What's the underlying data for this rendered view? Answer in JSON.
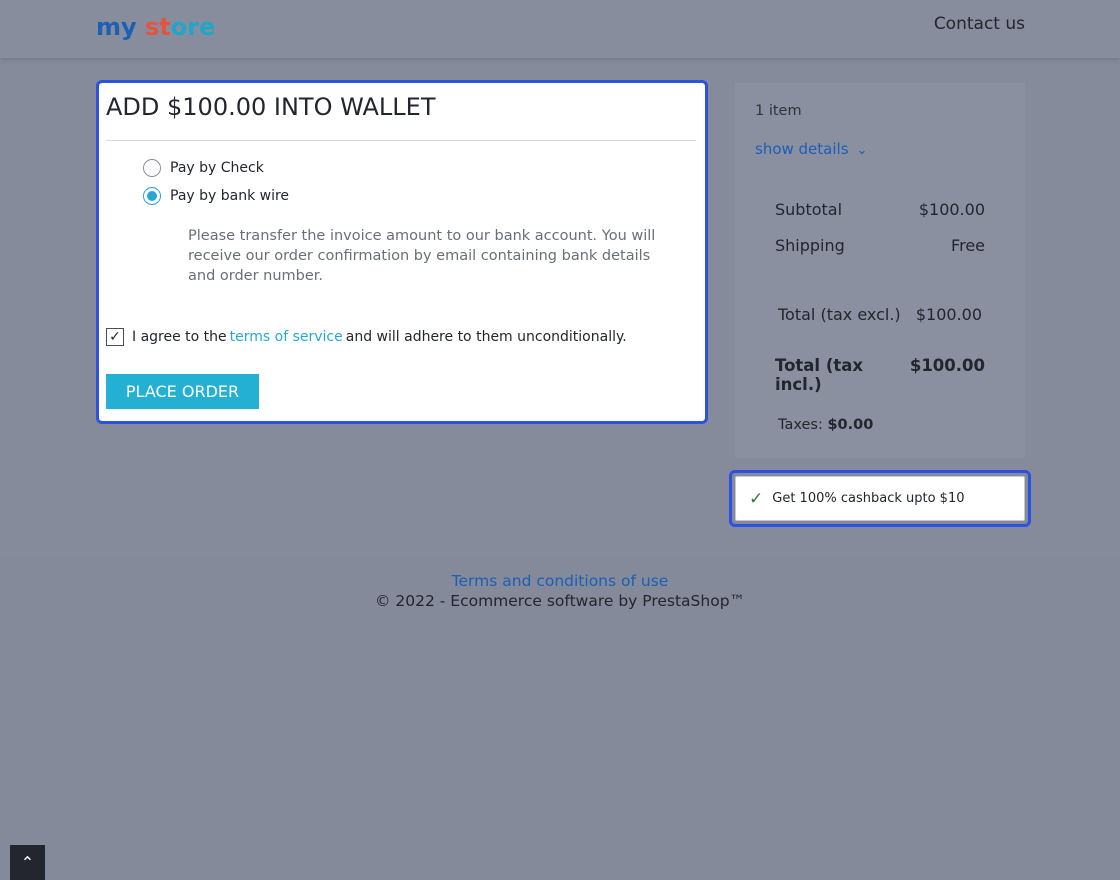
{
  "header": {
    "logo_part1": "my",
    "logo_part2": "st",
    "logo_part3": "ore",
    "contact_label": "Contact us"
  },
  "payment": {
    "title": "ADD $100.00 INTO WALLET",
    "options": [
      {
        "label": "Pay by Check",
        "checked": false
      },
      {
        "label": "Pay by bank wire",
        "checked": true
      }
    ],
    "instructions": "Please transfer the invoice amount to our bank account. You will receive our order confirmation by email containing bank details and order number.",
    "agree_prefix": "I agree to the",
    "agree_link": "terms of service",
    "agree_suffix": "and will adhere to them unconditionally.",
    "agree_checked": true,
    "place_order_label": "PLACE ORDER"
  },
  "summary": {
    "items_count": "1 item",
    "show_details": "show details",
    "subtotal_label": "Subtotal",
    "subtotal_value": "$100.00",
    "shipping_label": "Shipping",
    "shipping_value": "Free",
    "total_excl_label": "Total (tax excl.)",
    "total_excl_value": "$100.00",
    "total_incl_label": "Total (tax incl.)",
    "total_incl_value": "$100.00",
    "taxes_label": "Taxes:",
    "taxes_value": "$0.00"
  },
  "cashback": {
    "text": "Get 100% cashback upto $10"
  },
  "footer": {
    "link": "Terms and conditions of use",
    "copyright": "© 2022 - Ecommerce software by PrestaShop™"
  },
  "colors": {
    "accent": "#23b0d3",
    "focus_border": "#2d52e0",
    "link": "#1a5fb8"
  }
}
